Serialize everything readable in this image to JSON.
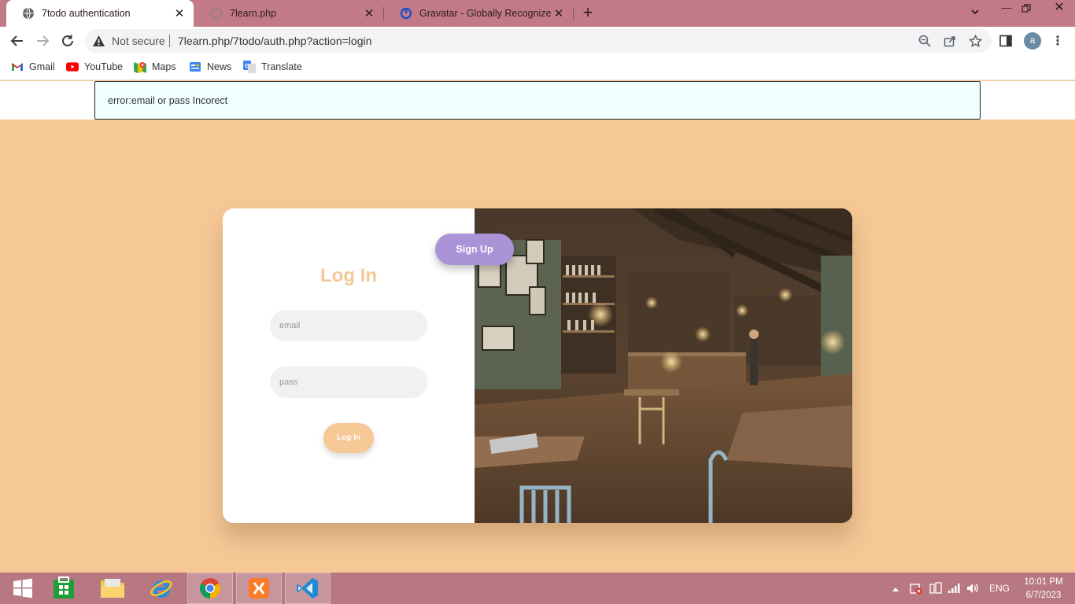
{
  "browser": {
    "tabs": [
      {
        "title": "7todo authentication",
        "icon": "globe-icon",
        "active": true
      },
      {
        "title": "7learn.php",
        "icon": "loading-icon",
        "active": false
      },
      {
        "title": "Gravatar - Globally Recognized A",
        "icon": "gravatar-icon",
        "active": false
      }
    ],
    "new_tab": "+",
    "address": {
      "security_label": "Not secure",
      "url": "7learn.php/7todo/auth.php?action=login"
    },
    "profile_initial": "a",
    "bookmarks": [
      {
        "label": "Gmail",
        "icon": "gmail-icon"
      },
      {
        "label": "YouTube",
        "icon": "youtube-icon"
      },
      {
        "label": "Maps",
        "icon": "maps-icon"
      },
      {
        "label": "News",
        "icon": "news-icon"
      },
      {
        "label": "Translate",
        "icon": "translate-icon"
      }
    ]
  },
  "page": {
    "error_message": "error:email or pass Incorect",
    "login": {
      "title": "Log In",
      "email_placeholder": "email",
      "pass_placeholder": "pass",
      "submit_label": "Log In"
    },
    "signup_label": "Sign Up",
    "colors": {
      "background": "#f6c896",
      "accent_orange": "#f6c896",
      "accent_purple": "#ab93d8",
      "error_bg": "#f0ffff"
    }
  },
  "taskbar": {
    "apps": [
      "start-icon",
      "store-icon",
      "file-explorer-icon",
      "internet-explorer-icon",
      "chrome-icon",
      "xampp-icon",
      "vscode-icon"
    ],
    "language": "ENG",
    "time": "10:01 PM",
    "date": "6/7/2023"
  }
}
